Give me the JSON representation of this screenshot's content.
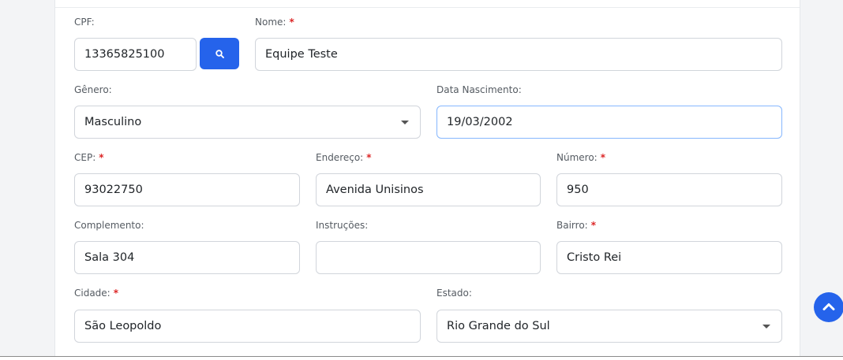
{
  "form": {
    "cpf": {
      "label": "CPF:",
      "value": "13365825100"
    },
    "nome": {
      "label": "Nome:",
      "required": "*",
      "value": "Equipe Teste"
    },
    "genero": {
      "label": "Gênero:",
      "value": "Masculino"
    },
    "data_nascimento": {
      "label": "Data Nascimento:",
      "value": "19/03/2002"
    },
    "cep": {
      "label": "CEP:",
      "required": "*",
      "value": "93022750"
    },
    "endereco": {
      "label": "Endereço:",
      "required": "*",
      "value": "Avenida Unisinos"
    },
    "numero": {
      "label": "Número:",
      "required": "*",
      "value": "950"
    },
    "complemento": {
      "label": "Complemento:",
      "value": "Sala 304"
    },
    "instrucoes": {
      "label": "Instruções:",
      "value": ""
    },
    "bairro": {
      "label": "Bairro:",
      "required": "*",
      "value": "Cristo Rei"
    },
    "cidade": {
      "label": "Cidade:",
      "required": "*",
      "value": "São Leopoldo"
    },
    "estado": {
      "label": "Estado:",
      "value": "Rio Grande do Sul"
    }
  },
  "icons": {
    "search": "search-icon",
    "scroll_top": "chevron-up-icon",
    "select_caret": "caret-down-icon"
  },
  "colors": {
    "primary": "#2563eb",
    "required": "#dc2626",
    "focus_border": "#86b7fe"
  }
}
